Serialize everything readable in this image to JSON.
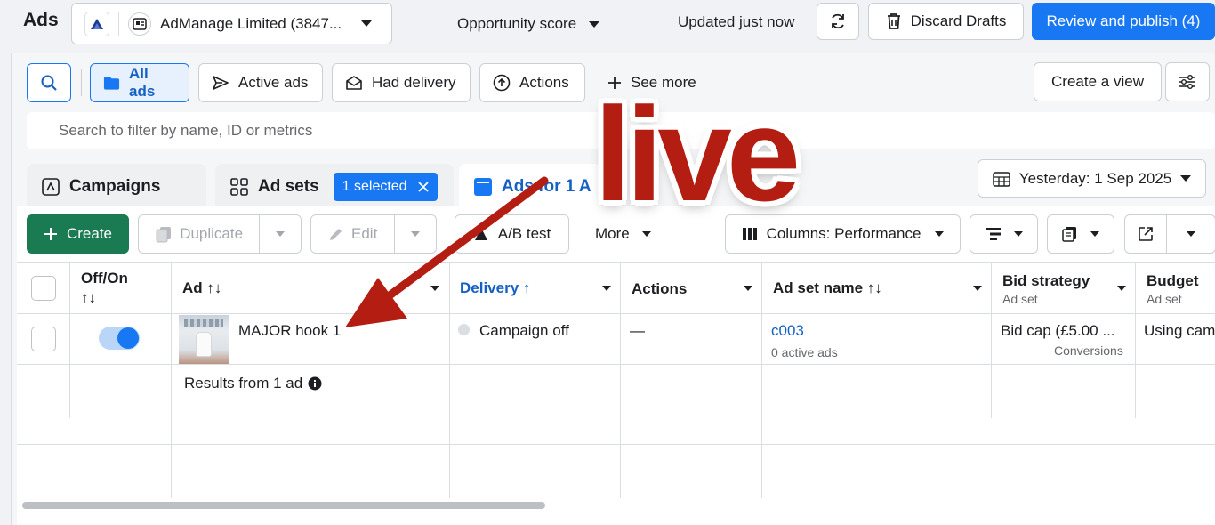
{
  "header": {
    "app_title": "Ads",
    "account_name": "AdManage Limited (3847...",
    "opportunity_label": "Opportunity score",
    "updated_text": "Updated just now",
    "discard_label": "Discard Drafts",
    "publish_label": "Review and publish (4)"
  },
  "filters": {
    "chips": [
      "All ads",
      "Active ads",
      "Had delivery",
      "Actions"
    ],
    "see_more_label": "See more",
    "create_view_label": "Create a view",
    "search_placeholder": "Search to filter by name, ID or metrics"
  },
  "tabs": {
    "campaigns": "Campaigns",
    "ad_sets": "Ad sets",
    "selected_badge": "1 selected",
    "ads": "Ads for 1 A"
  },
  "date_range": "Yesterday: 1 Sep 2025",
  "toolbar": {
    "create": "Create",
    "duplicate": "Duplicate",
    "edit": "Edit",
    "ab_test": "A/B test",
    "more": "More",
    "columns": "Columns: Performance"
  },
  "table": {
    "columns": {
      "off_on": "Off/On",
      "off_on_sort": "↑↓",
      "ad": "Ad ↑↓",
      "delivery": "Delivery ↑",
      "actions": "Actions",
      "ad_set_name": "Ad set name ↑↓",
      "bid_strategy": "Bid strategy",
      "bid_strategy_sub": "Ad set",
      "budget": "Budget",
      "budget_sub": "Ad set"
    },
    "rows": [
      {
        "toggle_on": true,
        "ad_name": "MAJOR hook 1",
        "delivery": "Campaign off",
        "actions": "—",
        "ad_set_name": "c003",
        "ad_set_sub": "0 active ads",
        "bid_strategy": "Bid cap (£5.00 ...",
        "bid_strategy_sub": "Conversions",
        "budget": "Using cam"
      }
    ],
    "results_text": "Results from 1 ad"
  },
  "annotation": {
    "overlay_word": "live"
  },
  "colors": {
    "primary": "#1877f2",
    "create_green": "#1a7a52",
    "annotation_red": "#b31d12"
  }
}
